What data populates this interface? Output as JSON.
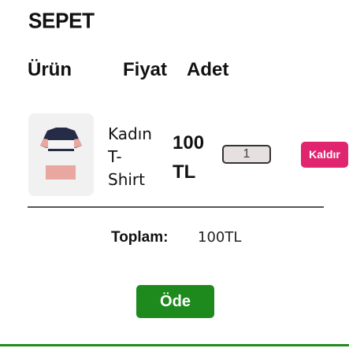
{
  "cart": {
    "title": "SEPET",
    "columns": {
      "product": "Ürün",
      "price": "Fiyat",
      "quantity": "Adet"
    },
    "items": [
      {
        "name_lines": [
          "Kadın",
          "T-",
          "Shirt"
        ],
        "price_lines": [
          "100",
          "TL"
        ],
        "quantity": "1",
        "remove_label": "Kaldır",
        "image_icon": "tshirt-image",
        "colors": {
          "top": "#262b46",
          "shoulder": "#e8a7a0",
          "middle": "#ffffff",
          "bottom": "#e8a7a0"
        }
      }
    ],
    "total_label": "Toplam:",
    "total_value": "100TL",
    "pay_label": "Öde"
  },
  "colors": {
    "remove_button": "#e0246f",
    "pay_button": "#1e8a1e",
    "accent_bar": "#1f8c1f"
  }
}
